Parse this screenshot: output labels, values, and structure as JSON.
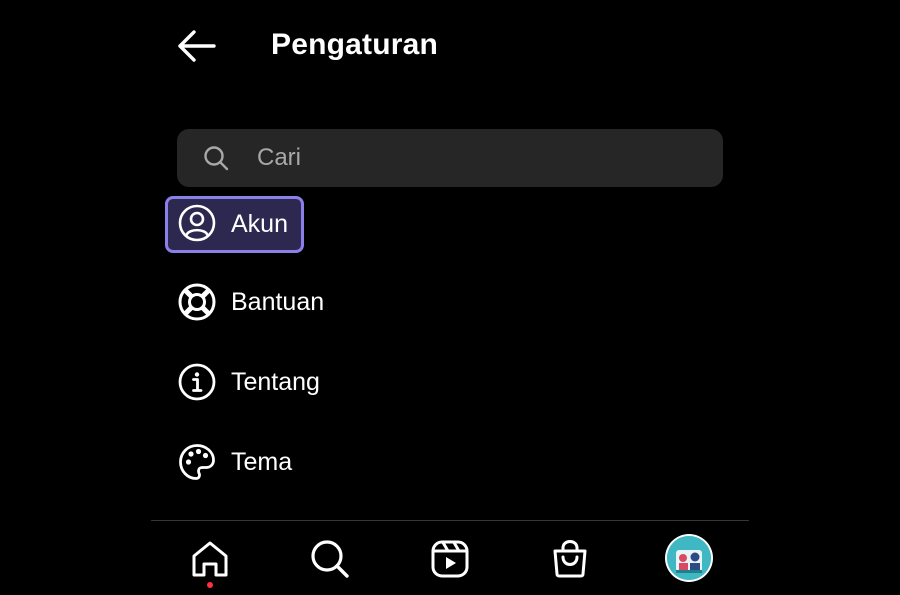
{
  "header": {
    "title": "Pengaturan",
    "back_icon": "arrow-left-icon"
  },
  "search": {
    "placeholder": "Cari",
    "value": "",
    "icon": "search-icon"
  },
  "menu": {
    "items": [
      {
        "label": "Akun",
        "icon": "account-circle-icon",
        "selected": true
      },
      {
        "label": "Bantuan",
        "icon": "lifebuoy-icon",
        "selected": false
      },
      {
        "label": "Tentang",
        "icon": "info-icon",
        "selected": false
      },
      {
        "label": "Tema",
        "icon": "palette-icon",
        "selected": false
      }
    ]
  },
  "bottom_nav": {
    "items": [
      {
        "name": "home",
        "icon": "home-icon",
        "has_notification": true
      },
      {
        "name": "search",
        "icon": "search-icon"
      },
      {
        "name": "reels",
        "icon": "reels-icon"
      },
      {
        "name": "shop",
        "icon": "shopping-bag-icon"
      },
      {
        "name": "profile",
        "icon": "avatar"
      }
    ]
  },
  "colors": {
    "background": "#000000",
    "search_bg": "#262626",
    "highlight_bg": "#2c2850",
    "highlight_border": "#8b7fe8",
    "notification_dot": "#ff3040",
    "avatar_bg": "#3fb8c4"
  }
}
